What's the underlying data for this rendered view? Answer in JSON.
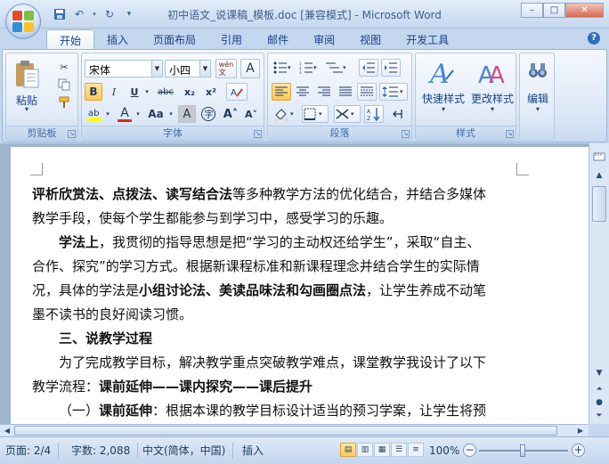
{
  "window": {
    "title": "初中语文_说课稿_模板.doc [兼容模式] - Microsoft Word",
    "minimize": "–",
    "maximize": "□",
    "close": "✕"
  },
  "tabs": [
    "开始",
    "插入",
    "页面布局",
    "引用",
    "邮件",
    "审阅",
    "视图",
    "开发工具"
  ],
  "active_tab": "开始",
  "ribbon": {
    "clipboard": {
      "paste_label": "粘贴",
      "group_label": "剪贴板"
    },
    "font": {
      "font_name": "宋体",
      "font_size": "小四",
      "group_label": "字体",
      "wen_label": "wén\n文",
      "bold": "B",
      "italic": "I",
      "underline": "U",
      "strike": "abc",
      "subscript": "x₂",
      "superscript": "x²",
      "font_color": "A",
      "change_case": "Aa",
      "grow": "A˄",
      "shrink": "A˅"
    },
    "paragraph": {
      "group_label": "段落"
    },
    "styles": {
      "quick_styles": "快速样式",
      "change_styles": "更改样式",
      "group_label": "样式"
    },
    "editing": {
      "label": "编辑"
    }
  },
  "document": {
    "lines": [
      {
        "parts": [
          {
            "t": "评析欣赏法、点拨法、读写结合法",
            "b": true
          },
          {
            "t": "等多种教学方法的优化结合，并结合多媒体",
            "b": false
          }
        ],
        "indent": false
      },
      {
        "parts": [
          {
            "t": "教学手段，使每个学生都能参与到学习中，感受学习的乐趣。",
            "b": false
          }
        ],
        "indent": false
      },
      {
        "parts": [
          {
            "t": "学法上",
            "b": true
          },
          {
            "t": "，我贯彻的指导思想是把“学习的主动权还给学生”，采取“自主、",
            "b": false
          }
        ],
        "indent": true
      },
      {
        "parts": [
          {
            "t": "合作、探究”的学习方式。根据新课程标准和新课程理念并结合学生的实际情",
            "b": false
          }
        ],
        "indent": false
      },
      {
        "parts": [
          {
            "t": "况，具体的学法是",
            "b": false
          },
          {
            "t": "小组讨论法、美读品味法和勾画圈点法",
            "b": true
          },
          {
            "t": "，让学生养成不动笔",
            "b": false
          }
        ],
        "indent": false
      },
      {
        "parts": [
          {
            "t": "墨不读书的良好阅读习惯。",
            "b": false
          }
        ],
        "indent": false
      },
      {
        "parts": [
          {
            "t": "三、说教学过程",
            "b": true
          }
        ],
        "indent": true
      },
      {
        "parts": [
          {
            "t": "为了完成教学目标，解决教学重点突破教学难点，课堂教学我设计了以下",
            "b": false
          }
        ],
        "indent": true
      },
      {
        "parts": [
          {
            "t": "教学流程：",
            "b": false
          },
          {
            "t": "课前延伸——课内探究——课后提升",
            "b": true
          }
        ],
        "indent": false
      },
      {
        "parts": [
          {
            "t": "（一）",
            "b": false
          },
          {
            "t": "课前延伸",
            "b": true
          },
          {
            "t": "：根据本课的教学目标设计适当的预习学案，让学生将预",
            "b": false
          }
        ],
        "indent": true
      }
    ]
  },
  "status": {
    "page": "页面: 2/4",
    "words": "字数: 2,088",
    "language": "中文(简体，中国)",
    "insert_mode": "插入",
    "zoom": "100%"
  }
}
